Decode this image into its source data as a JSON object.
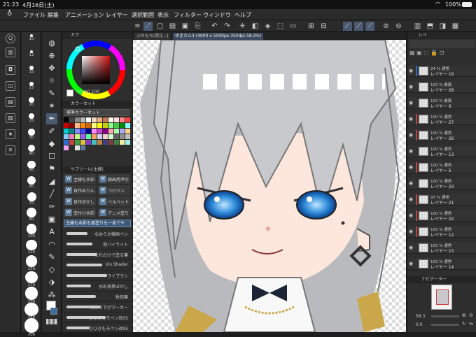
{
  "status": {
    "time": "21:23",
    "date": "4月16日(土)",
    "wifi": "wifi-icon",
    "battery": "100%"
  },
  "menu": [
    "ファイル",
    "編集",
    "アニメーション",
    "レイヤー",
    "選択範囲",
    "表示",
    "フィルター",
    "ウィンドウ",
    "ヘルプ"
  ],
  "tabs": [
    "ぶちもち(青)[...]",
    "ゆきさん3 (4000 x 5500px 350dpi 58.3%)"
  ],
  "brush_sizes": [
    "10",
    "12",
    "15",
    "17",
    "20",
    "25",
    "30",
    "40",
    "50",
    "60",
    "70",
    "80",
    "100",
    "120",
    "150",
    "170",
    "200",
    "250",
    "300"
  ],
  "color_panel": {
    "title": "カラ",
    "sliders_label": "100",
    "colorset_title": "カラーセット",
    "colorset_name": "標準カラーセット"
  },
  "subtool": {
    "title": "サブツール[水彩]",
    "header": "サブツール(主線)",
    "items": [
      {
        "label": "主線も水彩",
        "icon": "W"
      },
      {
        "label": "線画用滲引",
        "icon": "W"
      },
      {
        "label": "自作ぬりん",
        "icon": "W"
      },
      {
        "label": "つけペン",
        "icon": "W"
      },
      {
        "label": "自作ぼかし",
        "icon": "W"
      },
      {
        "label": "ベルベット",
        "icon": "W"
      },
      {
        "label": "塗付け水彩",
        "icon": "W"
      },
      {
        "label": "アニメ塗り",
        "icon": "W"
      }
    ],
    "selected_label": "主線も水彩も厚塗りも一本でや",
    "brushes": [
      "なめらか線画ペン",
      "骨ハイライト",
      "これだけで塗る筆",
      "Iris Shader",
      "ドライブラシ",
      "水彩境界ぼかし",
      "秋鉛筆",
      "大吊り下げマーカー",
      "ひひひもモペン改SS",
      "ひひひもモペン改SS"
    ]
  },
  "layers": [
    {
      "blend": "24 % 通常",
      "name": "レイヤー 16",
      "mark": "#2a6dd6"
    },
    {
      "blend": "100 % 乗算",
      "name": "レイヤー 28",
      "mark": "#333"
    },
    {
      "blend": "100 % 乗算",
      "name": "レイヤー 6",
      "mark": "#333"
    },
    {
      "blend": "100 % 通常",
      "name": "レイヤー 27",
      "mark": "#d04040"
    },
    {
      "blend": "100 % 通常",
      "name": "レイヤー 26",
      "mark": "#d04040"
    },
    {
      "blend": "100 % 通常",
      "name": "レイヤー 13",
      "mark": "#333"
    },
    {
      "blend": "100 % 通常",
      "name": "レイヤー 5",
      "mark": "#d04040"
    },
    {
      "blend": "100 % 通常",
      "name": "レイヤー 23",
      "mark": "#333"
    },
    {
      "blend": "97 % 通常",
      "name": "レイヤー 21",
      "mark": "#d04040"
    },
    {
      "blend": "100 % 通常",
      "name": "レイヤー 22",
      "mark": "#d04040"
    },
    {
      "blend": "100 % 通常",
      "name": "レイヤー 12",
      "mark": "#d04040"
    },
    {
      "blend": "100 % 通常",
      "name": "レイヤー 15",
      "mark": "#333"
    },
    {
      "blend": "100 % 通常",
      "name": "レイヤー 14",
      "mark": "#333"
    }
  ],
  "layer_panel_title": "レイ",
  "navigator": {
    "title": "ナビゲーター",
    "zoom": "58.3",
    "angle": "0.0"
  }
}
